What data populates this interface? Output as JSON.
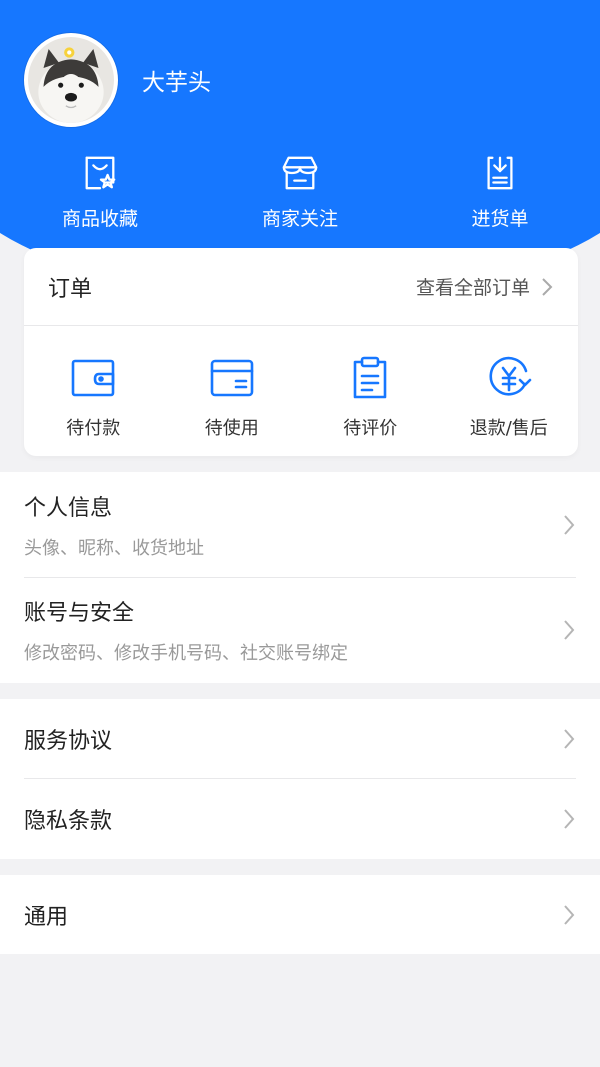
{
  "profile": {
    "username": "大芋头"
  },
  "quick_actions": [
    {
      "label": "商品收藏",
      "icon": "favorite-goods-icon"
    },
    {
      "label": "商家关注",
      "icon": "store-icon"
    },
    {
      "label": "进货单",
      "icon": "purchase-list-icon"
    }
  ],
  "orders": {
    "title": "订单",
    "view_all": "查看全部订单",
    "tabs": [
      {
        "label": "待付款",
        "icon": "wallet-icon"
      },
      {
        "label": "待使用",
        "icon": "card-icon"
      },
      {
        "label": "待评价",
        "icon": "clipboard-icon"
      },
      {
        "label": "退款/售后",
        "icon": "refund-icon"
      }
    ]
  },
  "menu": {
    "personal_info": {
      "title": "个人信息",
      "subtitle": "头像、昵称、收货地址"
    },
    "account_security": {
      "title": "账号与安全",
      "subtitle": "修改密码、修改手机号码、社交账号绑定"
    },
    "service_agreement": {
      "title": "服务协议"
    },
    "privacy_policy": {
      "title": "隐私条款"
    },
    "general": {
      "title": "通用"
    }
  },
  "colors": {
    "primary": "#1677ff",
    "background": "#f2f2f4"
  }
}
